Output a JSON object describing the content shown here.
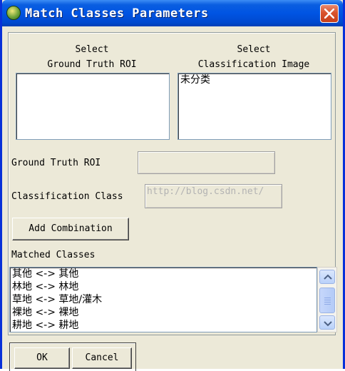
{
  "window": {
    "title": "Match Classes Parameters",
    "icon": "envi-globe-icon",
    "close_icon": "close-x-icon",
    "accent": "#0054e3"
  },
  "selectors": {
    "ground_truth": {
      "line1": "Select",
      "line2": "Ground Truth ROI",
      "items": []
    },
    "classification": {
      "line1": "Select",
      "line2": "Classification Image",
      "items": [
        "未分类"
      ]
    }
  },
  "fields": {
    "ground_truth_label": "Ground Truth ROI",
    "ground_truth_value": "",
    "classification_label": "Classification Class",
    "classification_value": ""
  },
  "watermark": "http://blog.csdn.net/",
  "buttons": {
    "add_combination": "Add Combination",
    "ok": "OK",
    "cancel": "Cancel"
  },
  "matched": {
    "label": "Matched Classes",
    "items": [
      "其他 <-> 其他",
      "林地 <-> 林地",
      "草地 <-> 草地/灌木",
      "裸地 <-> 裸地",
      "耕地 <-> 耕地"
    ]
  }
}
